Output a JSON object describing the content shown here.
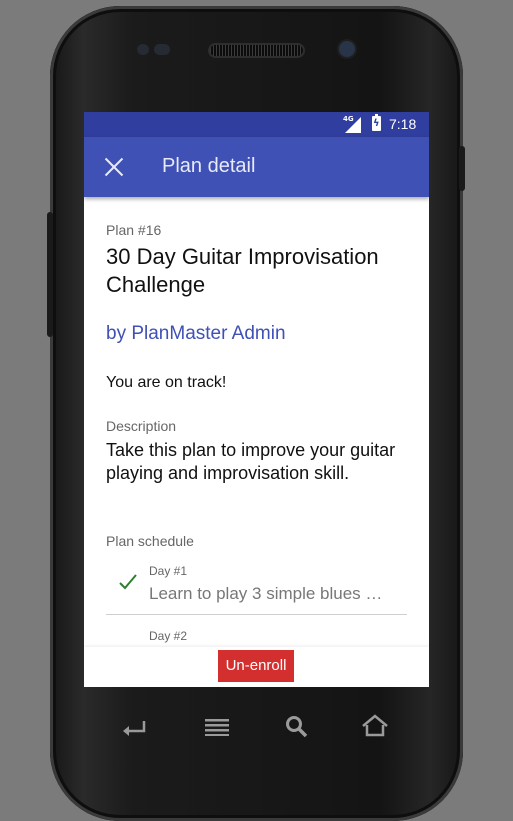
{
  "statusbar": {
    "network": "4G",
    "time": "7:18"
  },
  "appbar": {
    "title": "Plan detail",
    "close_icon": "close-icon"
  },
  "plan": {
    "number": "Plan #16",
    "title": "30 Day Guitar Improvisation Challenge",
    "author": "by PlanMaster Admin",
    "status": "You are on track!",
    "description_label": "Description",
    "description": "Take this plan to improve your guitar playing and improvisation skill."
  },
  "schedule": {
    "label": "Plan schedule",
    "items": [
      {
        "day": "Day #1",
        "title": "Learn to play 3 simple blues …",
        "completed": true
      },
      {
        "day": "Day #2",
        "title": "",
        "completed": false
      }
    ]
  },
  "actions": {
    "unenroll": "Un-enroll"
  },
  "colors": {
    "primary": "#3f51b5",
    "primary_dark": "#303f9f",
    "accent_red": "#d32f2f",
    "check_green": "#2e7d32"
  }
}
